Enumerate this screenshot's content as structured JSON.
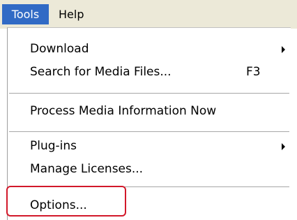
{
  "menubar": {
    "items": [
      {
        "label": "Tools"
      },
      {
        "label": "Help"
      }
    ]
  },
  "dropdown": {
    "items": [
      {
        "label": "Download",
        "submenu": true
      },
      {
        "label": "Search for Media Files...",
        "shortcut": "F3"
      },
      {
        "label": "Process Media Information Now"
      },
      {
        "label": "Plug-ins",
        "submenu": true
      },
      {
        "label": "Manage Licenses..."
      },
      {
        "label": "Options..."
      }
    ]
  },
  "colors": {
    "selection": "#316ac5",
    "highlight_outline": "#d2182a",
    "menubar_background": "#ece9d8"
  }
}
